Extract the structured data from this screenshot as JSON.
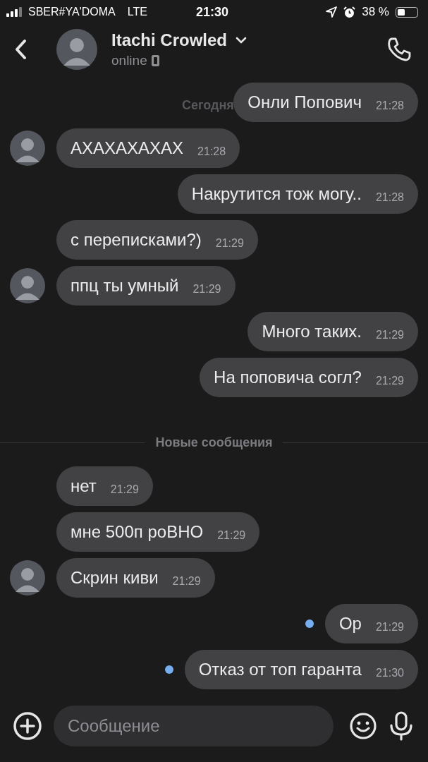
{
  "status_bar": {
    "carrier": "SBER#YA'DOMA",
    "network": "LTE",
    "time": "21:30",
    "battery": "38 %"
  },
  "header": {
    "name": "Itachi Crowled",
    "status": "online"
  },
  "date_label": "Сегодня",
  "messages": [
    {
      "kind": "outgoing",
      "text": "Онли Попович",
      "time": "21:28",
      "unread": false
    },
    {
      "kind": "incoming",
      "text": "АХАХАХАХАХ",
      "time": "21:28",
      "avatar": true
    },
    {
      "kind": "outgoing",
      "text": "Накрутится тож могу..",
      "time": "21:28",
      "unread": false
    },
    {
      "kind": "incoming",
      "text": "с переписками?)",
      "time": "21:29",
      "avatar": false
    },
    {
      "kind": "incoming",
      "text": "ппц ты умный",
      "time": "21:29",
      "avatar": true
    },
    {
      "kind": "outgoing",
      "text": "Много таких.",
      "time": "21:29",
      "unread": false
    },
    {
      "kind": "outgoing",
      "text": "На поповича согл?",
      "time": "21:29",
      "unread": false
    },
    {
      "kind": "divider",
      "text": "Новые сообщения"
    },
    {
      "kind": "incoming",
      "text": "нет",
      "time": "21:29",
      "avatar": false
    },
    {
      "kind": "incoming",
      "text": "мне 500п роВНО",
      "time": "21:29",
      "avatar": false
    },
    {
      "kind": "incoming",
      "text": "Скрин киви",
      "time": "21:29",
      "avatar": true
    },
    {
      "kind": "outgoing",
      "text": "Ор",
      "time": "21:29",
      "unread": true
    },
    {
      "kind": "outgoing",
      "text": "Отказ от топ гаранта",
      "time": "21:30",
      "unread": true
    }
  ],
  "composer": {
    "placeholder": "Сообщение"
  }
}
